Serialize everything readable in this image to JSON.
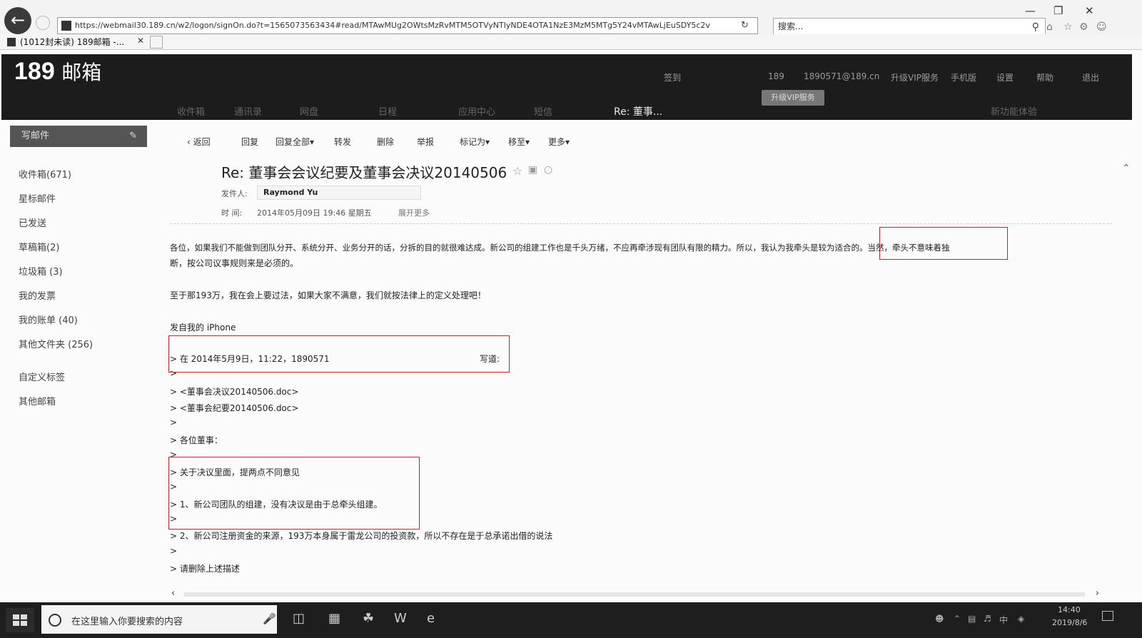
{
  "browser": {
    "url": "https://webmail30.189.cn/w2/logon/signOn.do?t=1565073563434#read/MTAwMUg2OWtsMzRvMTM5OTVyNTIyNDE4OTA1NzE3MzM5MTg5Y24vMTAwLjEuSDY5c2v",
    "search_placeholder": "搜索...",
    "tab_title": "(1012封未读) 189邮箱 -..."
  },
  "mail": {
    "logo_number": "189",
    "logo_text": "邮箱",
    "header_links": [
      "签到",
      "189",
      "1890571@189.cn",
      "升级VIP服务",
      "手机版",
      "设置",
      "帮助",
      "退出"
    ],
    "tooltip": "升级VIP服务",
    "nav_tabs": [
      "收件箱",
      "通讯录",
      "网盘",
      "日程",
      "应用中心",
      "短信"
    ],
    "active_tab": "Re: 董事...",
    "nav_right": "新功能体验"
  },
  "sidebar": {
    "compose_label": "写邮件",
    "folders": [
      "收件箱(671)",
      "星标邮件",
      "已发送",
      "草稿箱(2)",
      "垃圾箱 (3)",
      "我的发票",
      "我的账单 (40)",
      "其他文件夹 (256)",
      "自定义标签",
      "其他邮箱"
    ]
  },
  "toolbar": {
    "back": "返回",
    "reply": "回复",
    "reply_all": "回复全部",
    "forward": "转发",
    "delete": "删除",
    "report": "举报",
    "mark_as": "标记为",
    "move_to": "移至",
    "more": "更多"
  },
  "message": {
    "subject": "Re: 董事会会议纪要及董事会决议20140506",
    "sender_label": "发件人:",
    "sender": "Raymond Yu",
    "time_label": "时 间:",
    "time": "2014年05月09日 19:46 星期五",
    "show_more": "展开更多",
    "body": [
      "各位，如果我们不能做到团队分开、系统分开、业务分开的话，分拆的目的就很难达成。新公司的组建工作也是千头万绪，不应再牵涉现有团队有限的精力。所以，我认为我牵头是较为适合的。当然，牵头不意味着独",
      "断，按公司议事规则来是必须的。",
      "至于那193万，我在会上要过法，如果大家不满意，我们就按法律上的定义处理吧！",
      "发自我的 iPhone"
    ],
    "quote": [
      "> 在 2014年5月9日，11:22，1890571",
      "写道:",
      ">",
      "> <董事会决议20140506.doc>",
      "> <董事会纪要20140506.doc>",
      ">",
      "> 各位董事：",
      ">",
      "> 关于决议里面，提两点不同意见",
      ">",
      "> 1、新公司团队的组建，没有决议是由于总牵头组建。",
      ">",
      "> 2、新公司注册资金的来源，193万本身属于雷龙公司的投资款，所以不存在是于总承诺出借的说法",
      ">",
      "> 请删除上述描述"
    ]
  },
  "taskbar": {
    "search_placeholder": "在这里输入你要搜索的内容",
    "time": "14:40",
    "date": "2019/8/6"
  }
}
